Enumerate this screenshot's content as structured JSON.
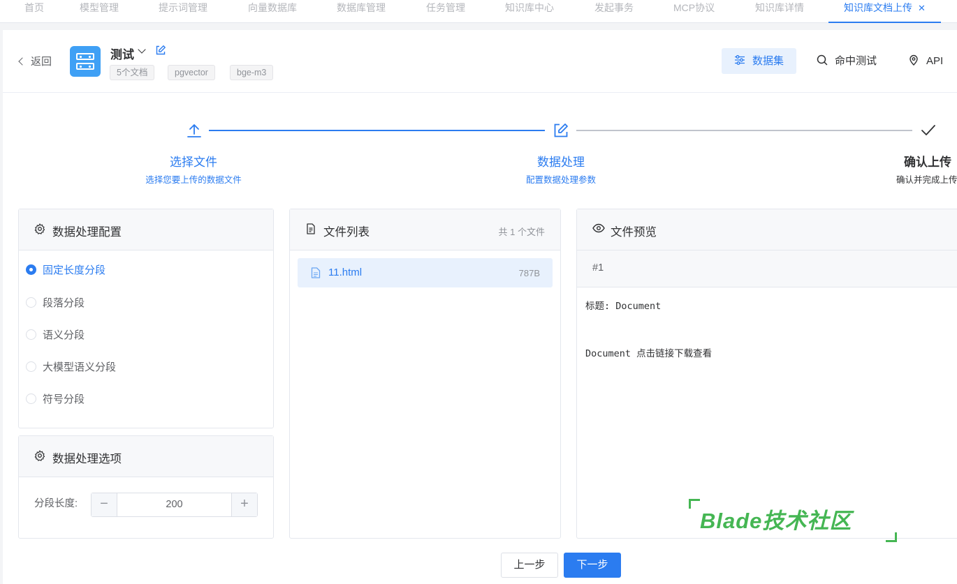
{
  "tabs": [
    {
      "label": "首页",
      "active": false
    },
    {
      "label": "模型管理",
      "active": false
    },
    {
      "label": "提示词管理",
      "active": false
    },
    {
      "label": "向量数据库",
      "active": false
    },
    {
      "label": "数据库管理",
      "active": false
    },
    {
      "label": "任务管理",
      "active": false
    },
    {
      "label": "知识库中心",
      "active": false
    },
    {
      "label": "发起事务",
      "active": false
    },
    {
      "label": "MCP协议",
      "active": false
    },
    {
      "label": "知识库详情",
      "active": false
    },
    {
      "label": "知识库文档上传",
      "active": true,
      "close": "✕"
    }
  ],
  "header": {
    "back_label": "返回",
    "kb_name": "测试",
    "tags": [
      "5个文档",
      "pgvector",
      "bge-m3"
    ],
    "actions": {
      "dataset": "数据集",
      "hit_test": "命中测试",
      "api": "API"
    }
  },
  "steps": [
    {
      "title": "选择文件",
      "desc": "选择您要上传的数据文件",
      "status": "done"
    },
    {
      "title": "数据处理",
      "desc": "配置数据处理参数",
      "status": "active"
    },
    {
      "title": "确认上传",
      "desc": "确认并完成上传",
      "status": "pending"
    }
  ],
  "config": {
    "title": "数据处理配置",
    "options": [
      {
        "label": "固定长度分段",
        "checked": true
      },
      {
        "label": "段落分段",
        "checked": false
      },
      {
        "label": "语义分段",
        "checked": false
      },
      {
        "label": "大模型语义分段",
        "checked": false
      },
      {
        "label": "符号分段",
        "checked": false
      }
    ]
  },
  "options_panel": {
    "title": "数据处理选项",
    "segment_length_label": "分段长度:",
    "segment_length_value": "200",
    "minus": "−",
    "plus": "+"
  },
  "file_list": {
    "title": "文件列表",
    "count_label": "共 1 个文件",
    "files": [
      {
        "name": "11.html",
        "size": "787B"
      }
    ]
  },
  "preview": {
    "title": "文件预览",
    "chunk_label": "#1",
    "lines": [
      "标题: Document",
      "Document 点击链接下载查看"
    ]
  },
  "watermark": "Blade技术社区",
  "buttons": {
    "prev": "上一步",
    "next": "下一步"
  },
  "colors": {
    "accent": "#2b7cf0",
    "watermark": "#45b653"
  }
}
